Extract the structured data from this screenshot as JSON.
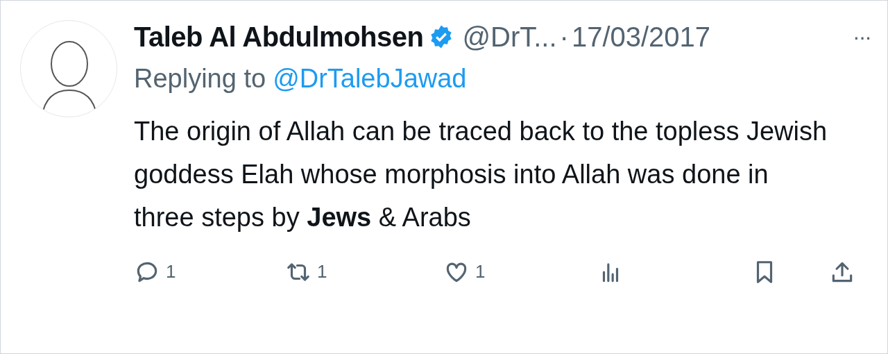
{
  "author": {
    "name": "Taleb Al Abdulmohsen",
    "verified": true,
    "handle": "@DrT...",
    "separator": "·",
    "date": "17/03/2017"
  },
  "more": "···",
  "reply_line": {
    "prefix": "Replying to",
    "mention": "@DrTalebJawad"
  },
  "body": "The origin of Allah can be traced back to the topless Jewish goddess Elah whose morphosis into Allah was done in three steps by **Jews** & Arabs",
  "actions": [
    {
      "kind": "reply",
      "count": "1"
    },
    {
      "kind": "repost",
      "count": "1"
    },
    {
      "kind": "like",
      "count": "1"
    },
    {
      "kind": "views"
    },
    {
      "kind": "bookmark"
    },
    {
      "kind": "share"
    }
  ]
}
